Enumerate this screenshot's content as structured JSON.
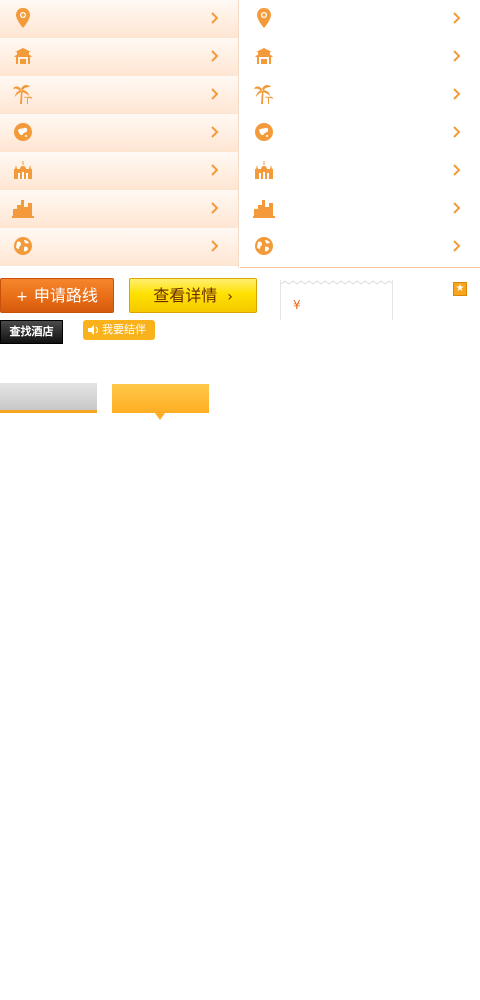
{
  "left_menu": {
    "items": [
      {
        "icon": "map-pin-icon"
      },
      {
        "icon": "pagoda-icon"
      },
      {
        "icon": "palm-tree-icon"
      },
      {
        "icon": "china-map-icon"
      },
      {
        "icon": "palace-icon"
      },
      {
        "icon": "city-skyline-icon"
      },
      {
        "icon": "globe-icon"
      }
    ]
  },
  "right_menu": {
    "items": [
      {
        "icon": "map-pin-icon"
      },
      {
        "icon": "pagoda-icon"
      },
      {
        "icon": "palm-tree-icon"
      },
      {
        "icon": "china-map-icon"
      },
      {
        "icon": "palace-icon"
      },
      {
        "icon": "city-skyline-icon"
      },
      {
        "icon": "globe-icon"
      }
    ]
  },
  "buttons": {
    "apply_route": "申请路线",
    "apply_plus": "+",
    "view_details": "查看详情",
    "find_hotel": "查找酒店",
    "join_group": "我要结伴"
  },
  "price": {
    "currency": "¥"
  },
  "colors": {
    "accent_orange": "#f39a3a",
    "apply_button": "#e86e18",
    "detail_button": "#ffe100",
    "group_button": "#f9b21c"
  }
}
